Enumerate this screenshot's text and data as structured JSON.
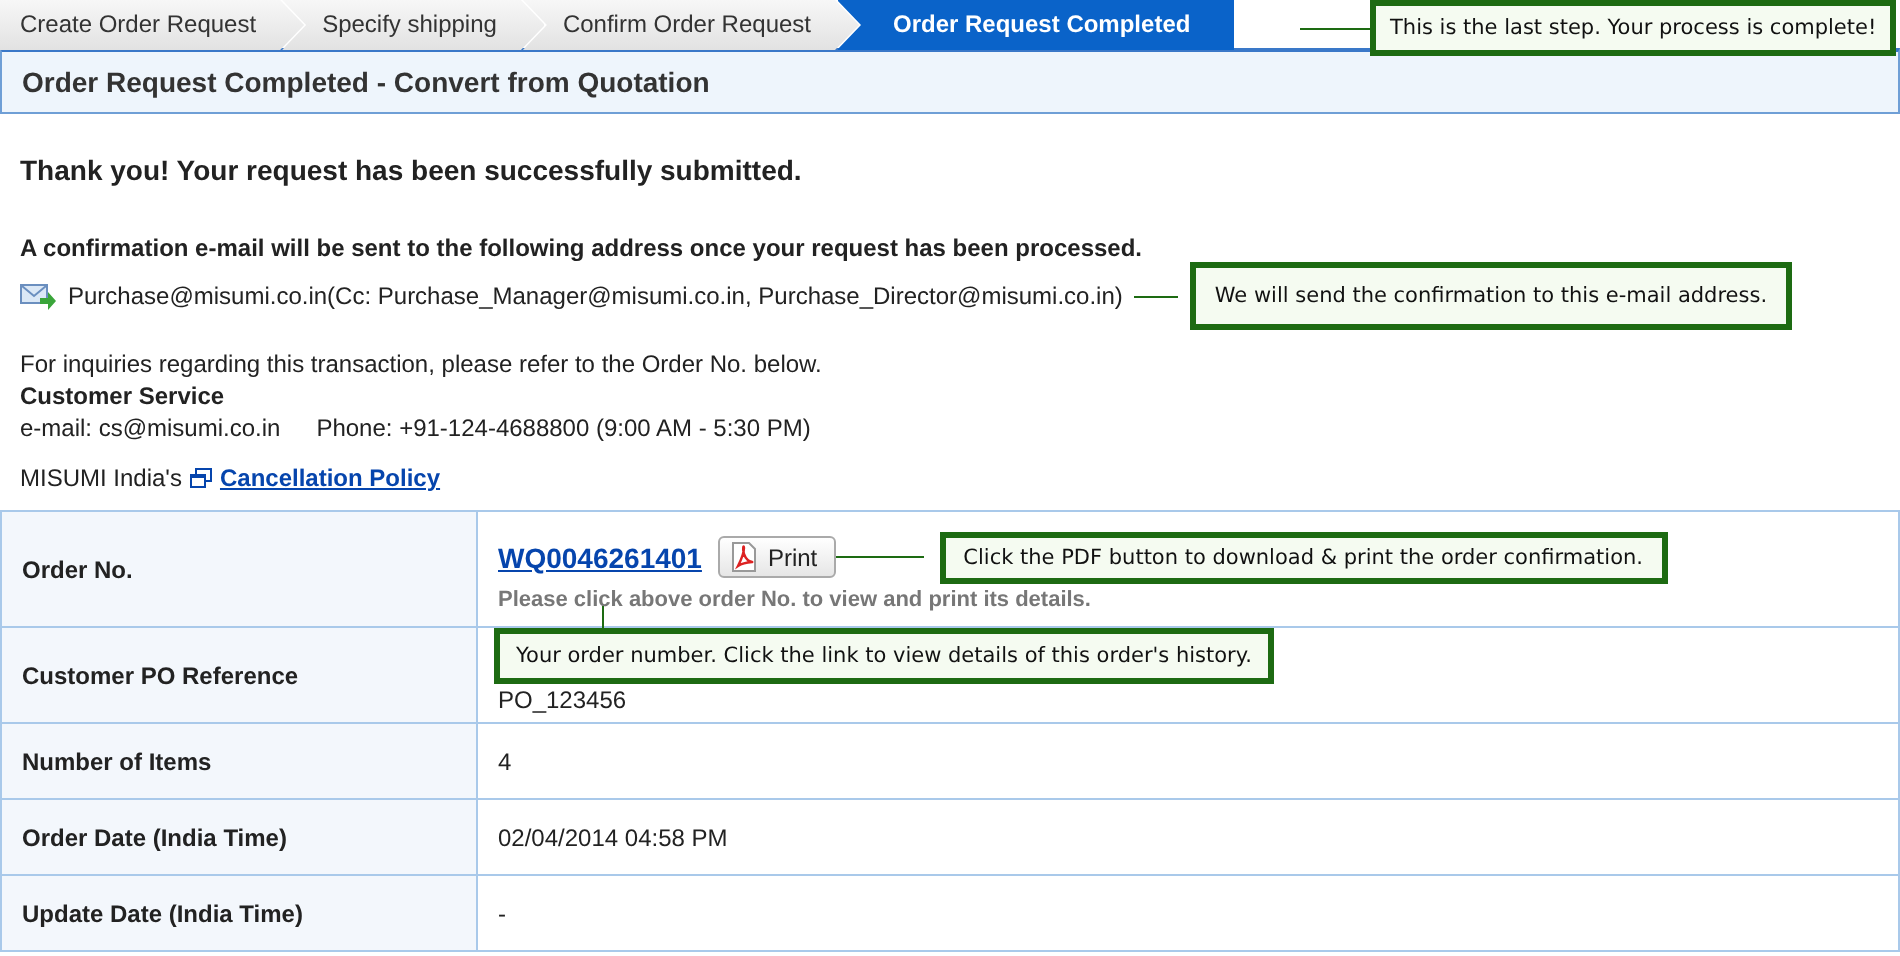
{
  "steps": [
    {
      "label": "Create Order Request",
      "selected": false
    },
    {
      "label": "Specify shipping",
      "selected": false
    },
    {
      "label": "Confirm Order Request",
      "selected": false
    },
    {
      "label": "Order Request Completed",
      "selected": true
    }
  ],
  "step_note": "This is the last step. Your process is complete!",
  "header": {
    "title": "Order Request Completed - Convert from Quotation"
  },
  "message": {
    "thanks": "Thank you! Your request has been successfully submitted.",
    "confirmation": "A confirmation e-mail will be sent to the following address once your request has been processed.",
    "email_line": "Purchase@misumi.co.in(Cc: Purchase_Manager@misumi.co.in, Purchase_Director@misumi.co.in)",
    "email_note": "We will send the confirmation to this e-mail address.",
    "inquiry": "For inquiries regarding this transaction, please refer to the Order No. below.",
    "service_title": "Customer Service",
    "contact_email": "e-mail: cs@misumi.co.in",
    "contact_phone": "Phone: +91-124-4688800 (9:00 AM - 5:30 PM)",
    "policy_prefix": "MISUMI India's",
    "policy_link": "Cancellation Policy"
  },
  "details": [
    {
      "kind": "order",
      "label": "Order No.",
      "value": "WQ0046261401",
      "button": "Print",
      "hint": "Please click above order No. to view and print its details.",
      "print_note": "Click the PDF button to download & print the order confirmation.",
      "order_note": "Your order number. Click the link to view details of this order's history."
    },
    {
      "kind": "text",
      "label": "Customer PO Reference",
      "value": "PO_123456"
    },
    {
      "kind": "text",
      "label": "Number of Items",
      "value": "4"
    },
    {
      "kind": "text",
      "label": "Order Date (India Time)",
      "value": "02/04/2014 04:58 PM"
    },
    {
      "kind": "text",
      "label": "Update Date (India Time)",
      "value": "-"
    }
  ]
}
